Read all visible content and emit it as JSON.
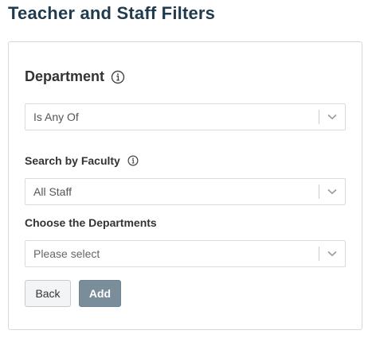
{
  "page": {
    "title": "Teacher and Staff Filters"
  },
  "department": {
    "title": "Department",
    "title_icon": "info-icon",
    "operator_select": {
      "value": "Is Any Of",
      "caret_icon": "chevron-down-icon"
    }
  },
  "faculty": {
    "label": "Search by Faculty",
    "label_icon": "info-icon",
    "select": {
      "value": "All Staff",
      "caret_icon": "chevron-down-icon"
    }
  },
  "departments_choice": {
    "label": "Choose the Departments",
    "select": {
      "placeholder": "Please select",
      "caret_icon": "chevron-down-icon"
    }
  },
  "actions": {
    "back_label": "Back",
    "add_label": "Add"
  },
  "colors": {
    "title": "#1f3b4d",
    "add_button_bg": "#7a8d9b",
    "back_button_bg": "#f3f4f5",
    "border": "#d5d8dc"
  }
}
